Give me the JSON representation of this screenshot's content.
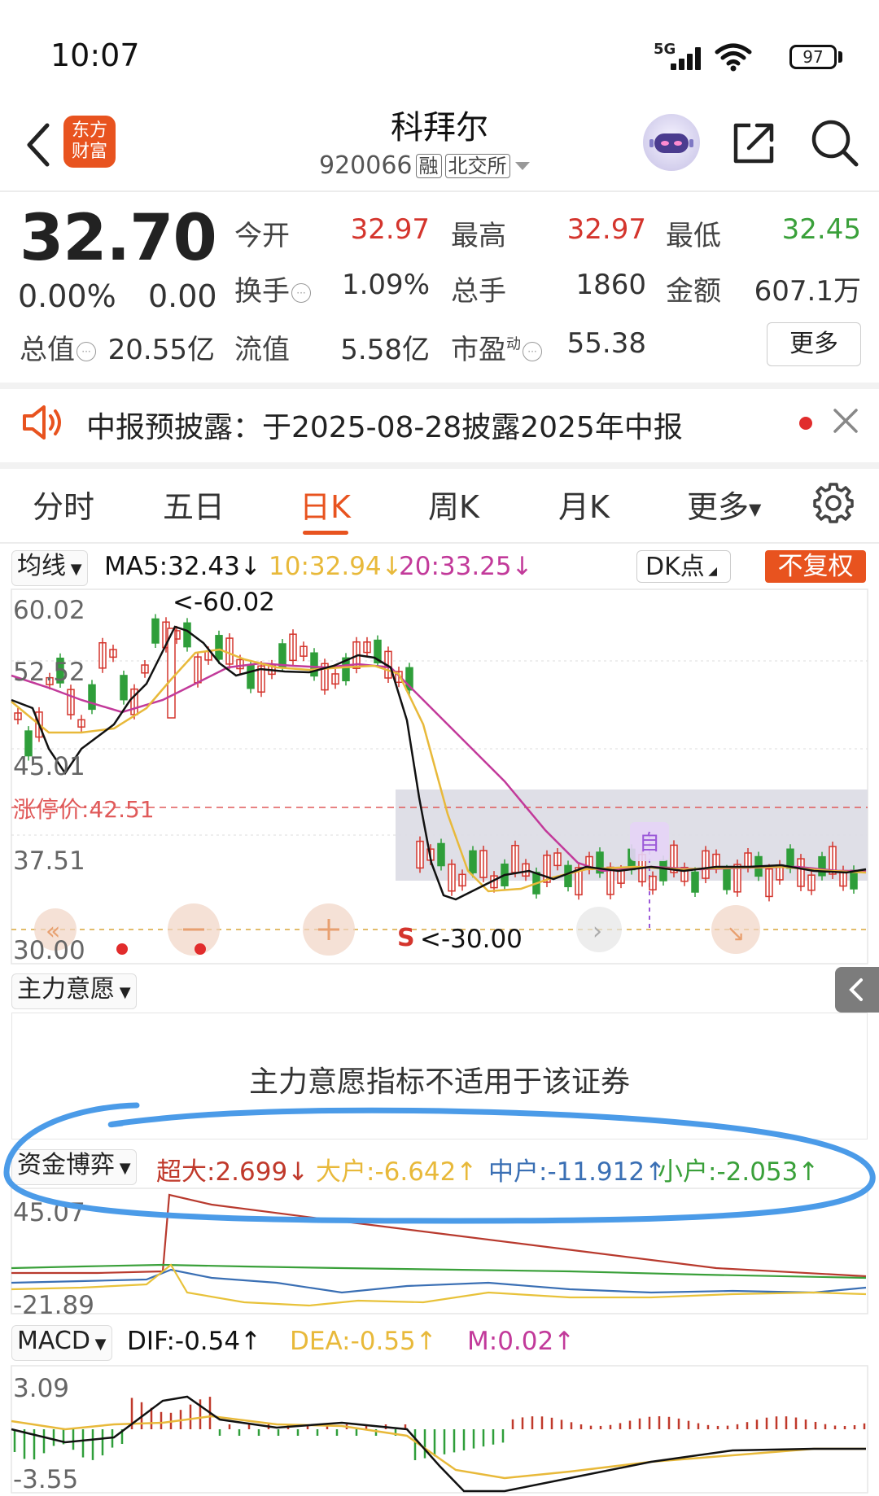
{
  "status_bar": {
    "time": "10:07",
    "network": "5G",
    "battery": "97"
  },
  "header": {
    "logo_text_1": "东方",
    "logo_text_2": "财富",
    "stock_name": "科拜尔",
    "stock_code": "920066",
    "tag_margin": "融",
    "tag_exchange": "北交所"
  },
  "quote": {
    "price": "32.70",
    "change_pct": "0.00%",
    "change": "0.00",
    "open_label": "今开",
    "open": "32.97",
    "high_label": "最高",
    "high": "32.97",
    "low_label": "最低",
    "low": "32.45",
    "turnover_label": "换手",
    "turnover": "1.09%",
    "volume_label": "总手",
    "volume": "1860",
    "amount_label": "金额",
    "amount": "607.1万",
    "mktcap_label": "总值",
    "mktcap": "20.55亿",
    "float_label": "流值",
    "float_cap": "5.58亿",
    "pe_label": "市盈",
    "pe_sup": "动",
    "pe": "55.38",
    "more_label": "更多"
  },
  "notice": {
    "text": "中报预披露：于2025-08-28披露2025年中报"
  },
  "tabs": [
    "分时",
    "五日",
    "日K",
    "周K",
    "月K",
    "更多"
  ],
  "active_tab": 2,
  "kline": {
    "indicator_select": "均线",
    "ma5": "MA5:32.43",
    "ma10": "10:32.94",
    "ma20": "20:33.25",
    "dk_label": "DK点",
    "fq_label": "不复权",
    "y_labels": [
      "60.02",
      "52.52",
      "45.01",
      "37.51",
      "30.00"
    ],
    "max_marker": "<-60.02",
    "min_marker": "<-30.00",
    "limit_label": "涨停价:42.51",
    "self_marker": "自",
    "s_marker": "S",
    "colors": {
      "ma5": "#111111",
      "ma10": "#e8b93a",
      "ma20": "#c23a9a",
      "up": "#d4352d",
      "down": "#2f9e3a"
    }
  },
  "zhuli": {
    "select": "主力意愿",
    "message": "主力意愿指标不适用于该证券"
  },
  "fund_game": {
    "select": "资金博弈",
    "super_large": "超大:2.699",
    "large": "大户:-6.642",
    "medium": "中户:-11.912",
    "small": "小户:-2.053",
    "y_labels": [
      "45.07",
      "-21.89"
    ]
  },
  "macd": {
    "select": "MACD",
    "dif": "DIF:-0.54",
    "dea": "DEA:-0.55",
    "m": "M:0.02",
    "y_labels": [
      "3.09",
      "-3.55"
    ]
  }
}
